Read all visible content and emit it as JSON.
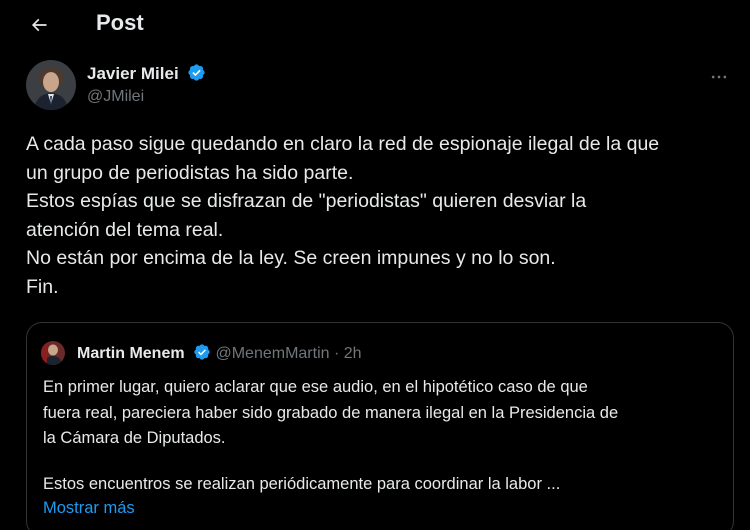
{
  "header": {
    "back_icon": "arrow-left-icon",
    "title": "Post"
  },
  "author": {
    "name": "Javier Milei",
    "handle": "@JMilei",
    "verified_icon": "verified-badge-icon",
    "more_icon": "more-horizontal-icon"
  },
  "tweet": {
    "lines": [
      "A cada paso sigue quedando en claro la red de espionaje ilegal de la que",
      "un grupo de periodistas ha sido parte.",
      "Estos espías que se disfrazan de \"periodistas\" quieren desviar la",
      "atención del tema real.",
      "No están por encima de la ley. Se creen impunes y no lo son.",
      "Fin."
    ]
  },
  "quote": {
    "name": "Martin Menem",
    "handle": "@MenemMartin",
    "separator": "·",
    "time": "2h",
    "lines": [
      "En primer lugar, quiero aclarar que ese audio, en el hipotético caso de que",
      "fuera real, pareciera haber sido grabado de manera ilegal en la Presidencia de",
      "la Cámara de Diputados."
    ],
    "lines2": [
      "Estos encuentros se realizan periódicamente para coordinar la labor ..."
    ],
    "show_more": "Mostrar más"
  },
  "colors": {
    "background": "#000000",
    "text": "#e7e9ea",
    "secondary": "#71767b",
    "accent": "#1d9bf0",
    "border": "#2f3336"
  }
}
